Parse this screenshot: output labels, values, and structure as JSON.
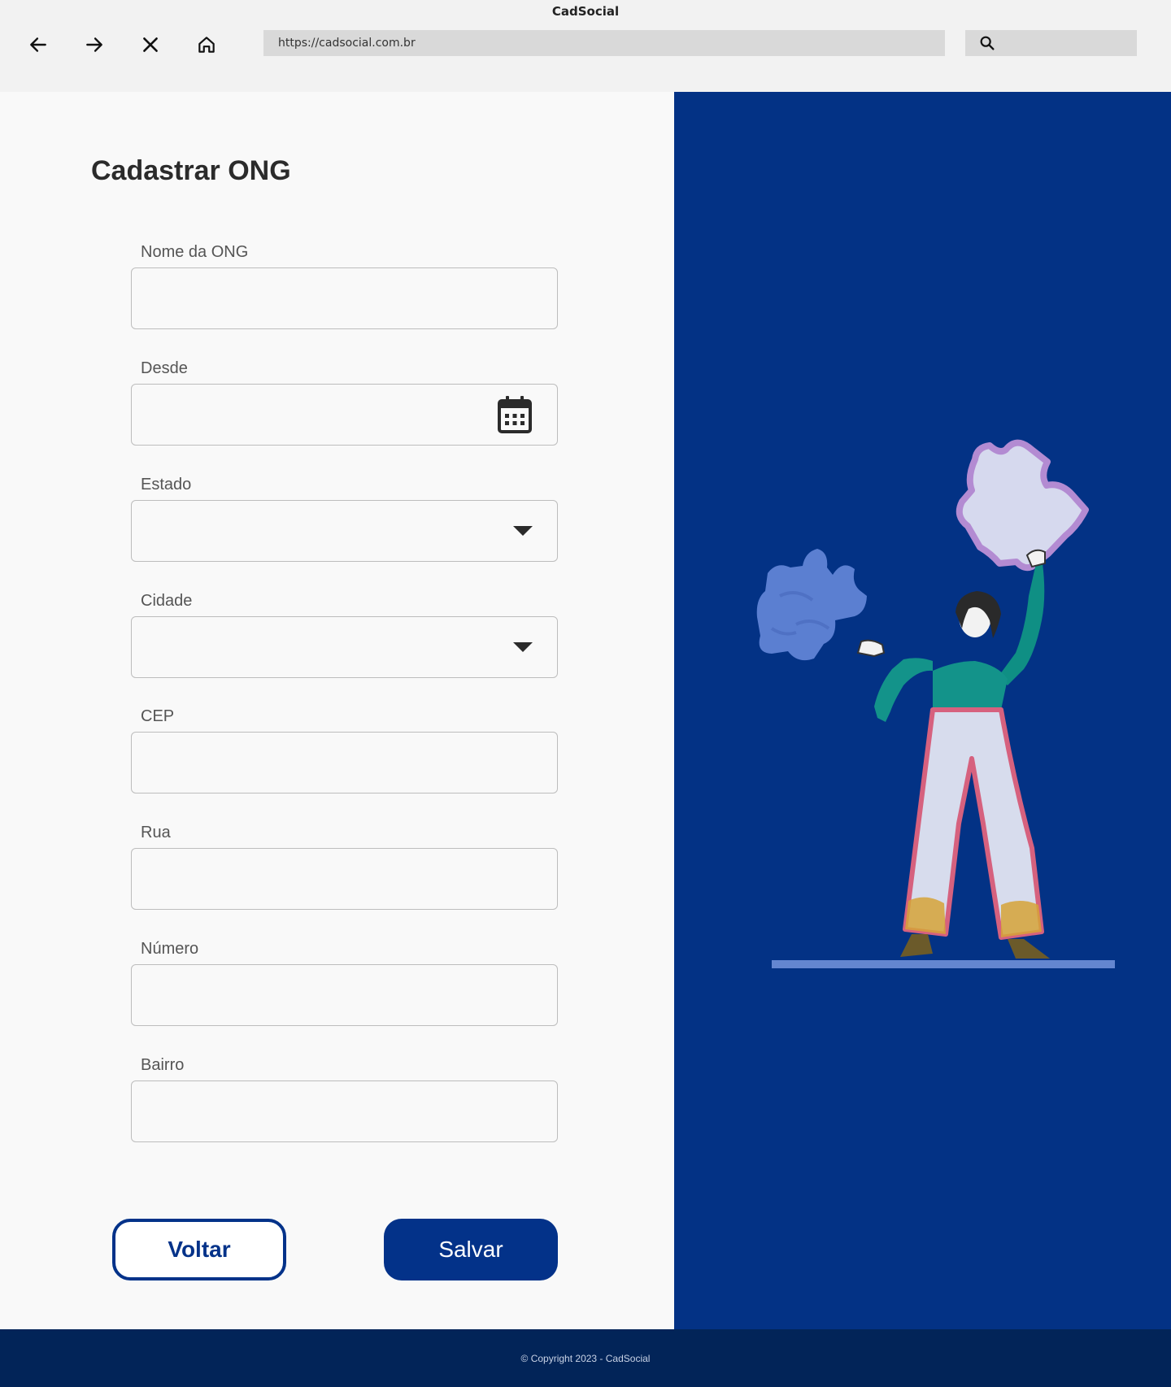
{
  "browser": {
    "window_title": "CadSocial",
    "url": "https://cadsocial.com.br",
    "nav_icons": [
      "back-arrow-icon",
      "forward-arrow-icon",
      "close-icon",
      "home-icon"
    ],
    "search_icon": "search-icon"
  },
  "form": {
    "title": "Cadastrar ONG",
    "fields": {
      "nome": {
        "label": "Nome da ONG",
        "value": ""
      },
      "desde": {
        "label": "Desde",
        "value": "",
        "icon": "calendar-icon"
      },
      "estado": {
        "label": "Estado",
        "value": "",
        "icon": "dropdown-arrow-icon"
      },
      "cidade": {
        "label": "Cidade",
        "value": "",
        "icon": "dropdown-arrow-icon"
      },
      "cep": {
        "label": "CEP",
        "value": ""
      },
      "rua": {
        "label": "Rua",
        "value": ""
      },
      "numero": {
        "label": "Número",
        "value": ""
      },
      "bairro": {
        "label": "Bairro",
        "value": ""
      }
    },
    "buttons": {
      "back_label": "Voltar",
      "save_label": "Salvar"
    }
  },
  "footer": {
    "copyright": "© Copyright 2023 - CadSocial"
  },
  "colors": {
    "primary": "#033289",
    "panel_blue": "#033285",
    "footer_blue": "#022458",
    "form_bg": "#f9f9f9"
  }
}
